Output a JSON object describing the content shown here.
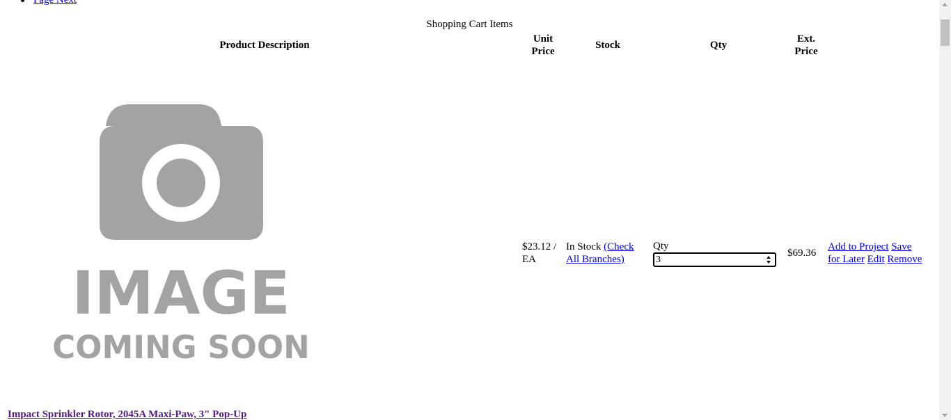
{
  "pager": {
    "next_label": "Page Next"
  },
  "cart": {
    "caption": "Shopping Cart Items",
    "headers": {
      "description": "Product Description",
      "unit_price_line1": "Unit",
      "unit_price_line2": "Price",
      "stock": "Stock",
      "qty": "Qty",
      "ext_price_line1": "Ext.",
      "ext_price_line2": "Price"
    },
    "item": {
      "image_text_line1": "IMAGE",
      "image_text_line2": "COMING SOON",
      "unit_price_line1": "$23.12 /",
      "unit_price_line2": "EA",
      "stock_status": "In Stock",
      "check_branches_line1": "(Check",
      "check_branches_line2": "All Branches)",
      "qty_label": "Qty",
      "qty_value": "3",
      "ext_price": "$69.36",
      "add_to_project": "Add to Project",
      "save_line1": "Save",
      "save_line2": "for Later",
      "edit": "Edit",
      "remove": "Remove",
      "title": "Impact Sprinkler Rotor, 2045A Maxi-Paw, 3\" Pop-Up"
    }
  }
}
